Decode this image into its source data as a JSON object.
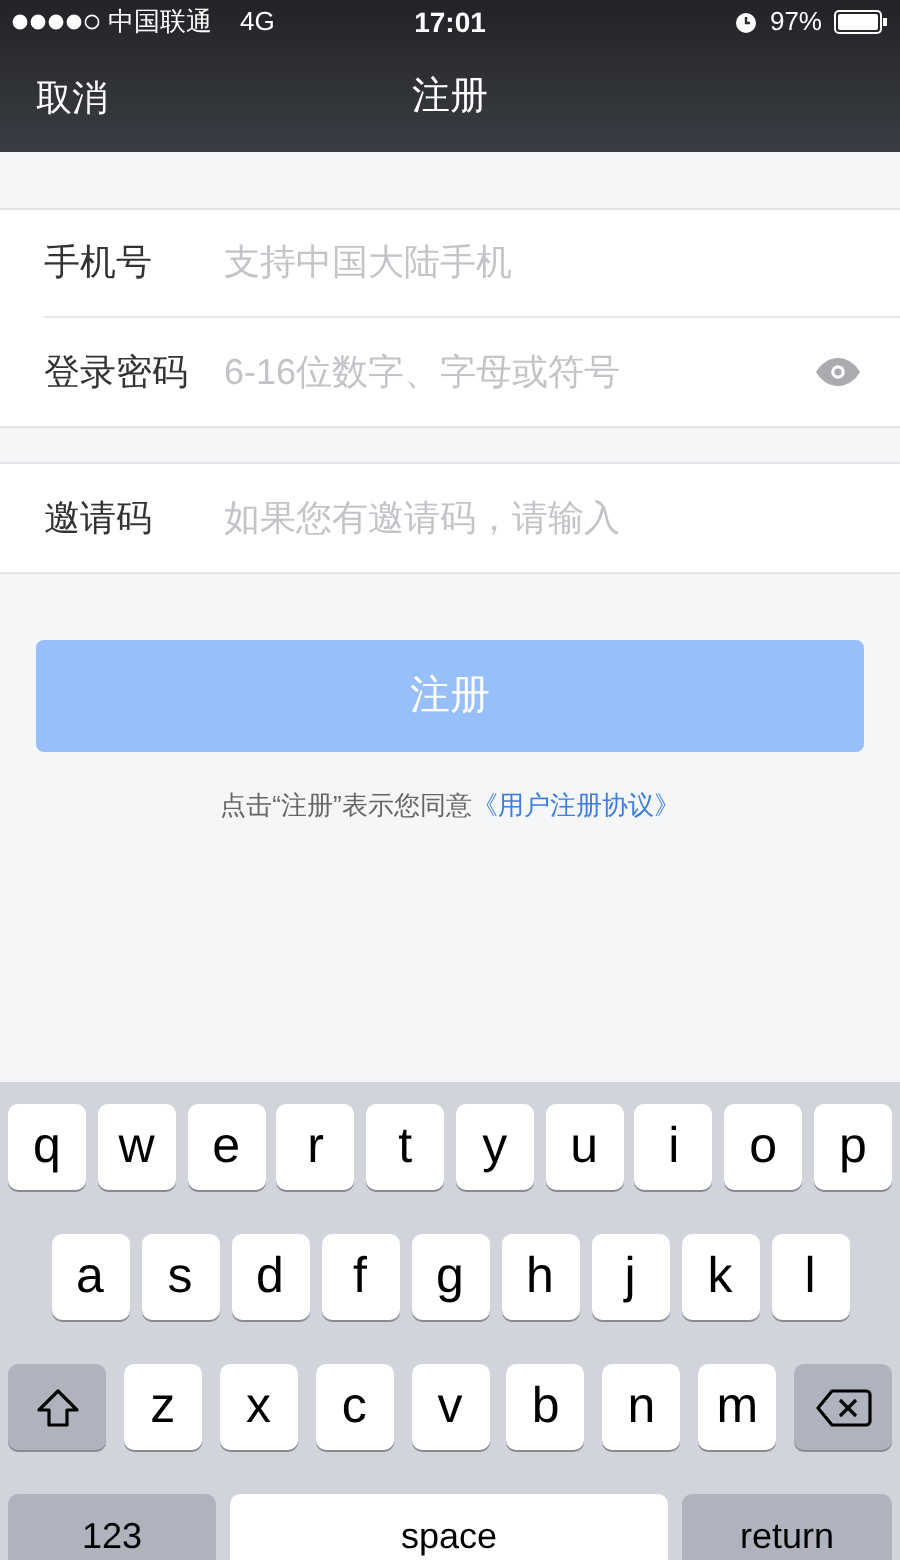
{
  "status_bar": {
    "carrier": "中国联通",
    "network": "4G",
    "time": "17:01",
    "battery": "97%"
  },
  "nav": {
    "cancel": "取消",
    "title": "注册"
  },
  "field_groups": [
    {
      "fields": [
        {
          "label": "手机号",
          "placeholder": "支持中国大陆手机",
          "kind": "text"
        },
        {
          "label": "登录密码",
          "placeholder": "6-16位数字、字母或符号",
          "kind": "password"
        }
      ]
    },
    {
      "fields": [
        {
          "label": "邀请码",
          "placeholder": "如果您有邀请码，请输入",
          "kind": "text"
        }
      ]
    }
  ],
  "register_button": {
    "label": "注册",
    "disabled": true
  },
  "agreement": {
    "text": "点击“注册”表示您同意",
    "link": "《用户注册协议》"
  },
  "keyboard": {
    "rows": [
      {
        "keys": [
          {
            "kind": "letter",
            "label": "q"
          },
          {
            "kind": "letter",
            "label": "w"
          },
          {
            "kind": "letter",
            "label": "e"
          },
          {
            "kind": "letter",
            "label": "r"
          },
          {
            "kind": "letter",
            "label": "t"
          },
          {
            "kind": "letter",
            "label": "y"
          },
          {
            "kind": "letter",
            "label": "u"
          },
          {
            "kind": "letter",
            "label": "i"
          },
          {
            "kind": "letter",
            "label": "o"
          },
          {
            "kind": "letter",
            "label": "p"
          }
        ]
      },
      {
        "keys": [
          {
            "kind": "letter",
            "label": "a"
          },
          {
            "kind": "letter",
            "label": "s"
          },
          {
            "kind": "letter",
            "label": "d"
          },
          {
            "kind": "letter",
            "label": "f"
          },
          {
            "kind": "letter",
            "label": "g"
          },
          {
            "kind": "letter",
            "label": "h"
          },
          {
            "kind": "letter",
            "label": "j"
          },
          {
            "kind": "letter",
            "label": "k"
          },
          {
            "kind": "letter",
            "label": "l"
          }
        ]
      },
      {
        "keys": [
          {
            "kind": "shift"
          },
          {
            "kind": "letter",
            "label": "z"
          },
          {
            "kind": "letter",
            "label": "x"
          },
          {
            "kind": "letter",
            "label": "c"
          },
          {
            "kind": "letter",
            "label": "v"
          },
          {
            "kind": "letter",
            "label": "b"
          },
          {
            "kind": "letter",
            "label": "n"
          },
          {
            "kind": "letter",
            "label": "m"
          },
          {
            "kind": "delete"
          }
        ]
      },
      {
        "keys": [
          {
            "kind": "mode",
            "label": "123"
          },
          {
            "kind": "space",
            "label": "space"
          },
          {
            "kind": "return",
            "label": "return"
          }
        ]
      }
    ]
  }
}
